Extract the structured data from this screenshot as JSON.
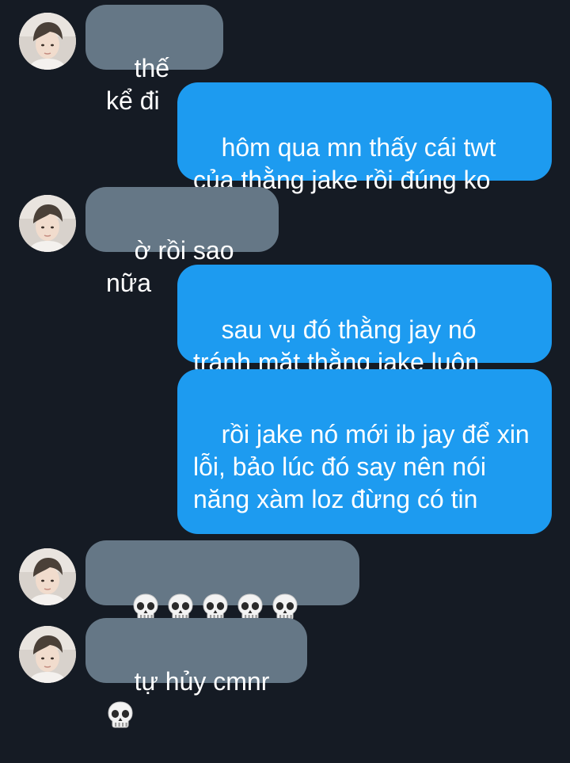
{
  "thread": {
    "messages": [
      {
        "side": "in",
        "text": "thế kể đi",
        "avatar": "avatar-a"
      },
      {
        "side": "out",
        "text": "hôm qua mn thấy cái twt\ncủa thằng jake rồi đúng ko"
      },
      {
        "side": "in",
        "text": "ờ rồi sao nữa",
        "avatar": "avatar-a"
      },
      {
        "side": "out",
        "text": "sau vụ đó thằng jay nó\ntránh mặt thằng jake luôn"
      },
      {
        "side": "out",
        "text": "rồi jake nó mới ib jay để xin\nlỗi, bảo lúc đó say nên nói\nnăng xàm loz đừng có tin",
        "emoji": "💀💀💀"
      },
      {
        "side": "in",
        "text": "",
        "emoji": "💀💀💀💀💀💀💀",
        "avatar": "avatar-b"
      },
      {
        "side": "in",
        "text": "tự hủy cmnr ",
        "emoji": "💀",
        "avatar": "avatar-a"
      }
    ]
  },
  "icons": {
    "skull": "skull-emoji",
    "avatar": "profile-photo"
  },
  "colors": {
    "background": "#151b24",
    "incoming": "#657786",
    "outgoing": "#1d9bf0",
    "text": "#ffffff"
  }
}
